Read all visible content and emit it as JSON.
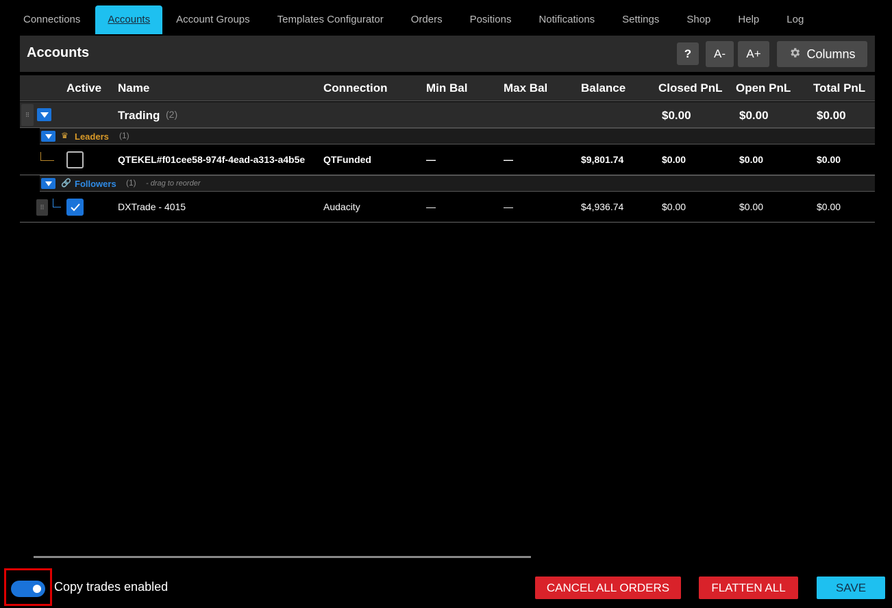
{
  "tabs": [
    "Connections",
    "Accounts",
    "Account Groups",
    "Templates Configurator",
    "Orders",
    "Positions",
    "Notifications",
    "Settings",
    "Shop",
    "Help",
    "Log"
  ],
  "active_tab": "Accounts",
  "header": {
    "title": "Accounts",
    "help_label": "?",
    "font_decrease_label": "A-",
    "font_increase_label": "A+",
    "columns_label": "Columns"
  },
  "columns": [
    "Active",
    "Name",
    "Connection",
    "Min Bal",
    "Max Bal",
    "Balance",
    "Closed PnL",
    "Open PnL",
    "Total PnL"
  ],
  "group": {
    "name": "Trading",
    "count": "(2)",
    "closed_pnl": "$0.00",
    "open_pnl": "$0.00",
    "total_pnl": "$0.00"
  },
  "leaders": {
    "label": "Leaders",
    "count": "(1)",
    "color": "#d99a28",
    "row": {
      "name": "QTEKEL#f01cee58-974f-4ead-a313-a4b5e",
      "connection": "QTFunded",
      "min_bal": "—",
      "max_bal": "—",
      "balance": "$9,801.74",
      "closed_pnl": "$0.00",
      "open_pnl": "$0.00",
      "total_pnl": "$0.00",
      "active": false
    }
  },
  "followers": {
    "label": "Followers",
    "count": "(1)",
    "hint": "- drag to reorder",
    "color": "#2f8be6",
    "row": {
      "name": "DXTrade - 4015",
      "connection": "Audacity",
      "min_bal": "—",
      "max_bal": "—",
      "balance": "$4,936.74",
      "closed_pnl": "$0.00",
      "open_pnl": "$0.00",
      "total_pnl": "$0.00",
      "active": true
    }
  },
  "footer": {
    "copy_trades_label": "Copy trades enabled",
    "copy_trades_enabled": true,
    "cancel_all_label": "CANCEL ALL ORDERS",
    "flatten_all_label": "FLATTEN ALL",
    "save_label": "SAVE"
  }
}
